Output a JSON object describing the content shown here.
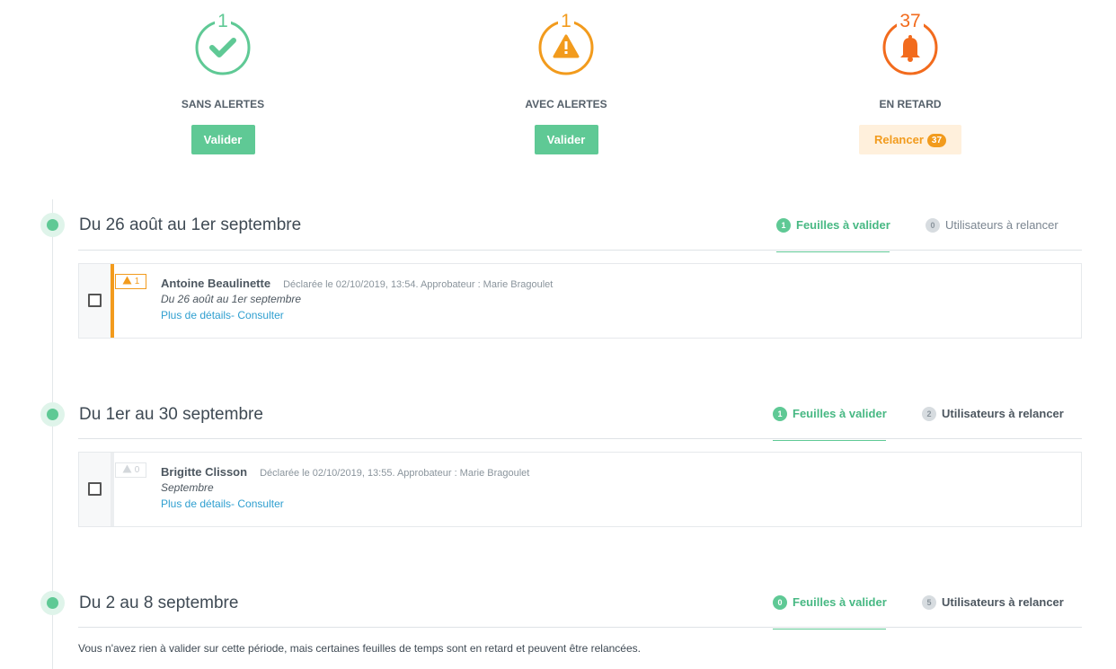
{
  "summary": [
    {
      "count": "1",
      "label": "SANS ALERTES",
      "button": "Valider"
    },
    {
      "count": "1",
      "label": "AVEC ALERTES",
      "button": "Valider"
    },
    {
      "count": "37",
      "label": "EN RETARD",
      "button": "Relancer",
      "badge": "37"
    }
  ],
  "sections": [
    {
      "title": "Du 26 août au 1er septembre",
      "tab_validate": {
        "count": "1",
        "label": "Feuilles à valider"
      },
      "tab_remind": {
        "count": "0",
        "label": "Utilisateurs à relancer"
      },
      "row": {
        "alert_count": "1",
        "name": "Antoine Beaulinette",
        "meta": "Déclarée le 02/10/2019, 13:54. Approbateur : Marie Bragoulet",
        "period": "Du 26 août au 1er septembre",
        "details_link": "Plus de détails",
        "separator": "-",
        "consult_link": " Consulter"
      }
    },
    {
      "title": "Du 1er au 30 septembre",
      "tab_validate": {
        "count": "1",
        "label": "Feuilles à valider"
      },
      "tab_remind": {
        "count": "2",
        "label": "Utilisateurs à relancer"
      },
      "row": {
        "alert_count": "0",
        "name": "Brigitte Clisson",
        "meta": "Déclarée le 02/10/2019, 13:55. Approbateur : Marie Bragoulet",
        "period": "Septembre",
        "details_link": "Plus de détails",
        "separator": "-",
        "consult_link": " Consulter"
      }
    },
    {
      "title": "Du 2 au 8 septembre",
      "tab_validate": {
        "count": "0",
        "label": "Feuilles à valider"
      },
      "tab_remind": {
        "count": "5",
        "label": "Utilisateurs à relancer"
      },
      "empty_message": "Vous n'avez rien à valider sur cette période, mais certaines feuilles de temps sont en retard et peuvent être relancées."
    }
  ],
  "icons": {
    "sans_alertes": "check-icon",
    "avec_alertes": "warning-icon",
    "en_retard": "bell-icon"
  },
  "colors": {
    "green": "#5fc995",
    "orange": "#f29b1d",
    "red": "#f26b1d"
  }
}
